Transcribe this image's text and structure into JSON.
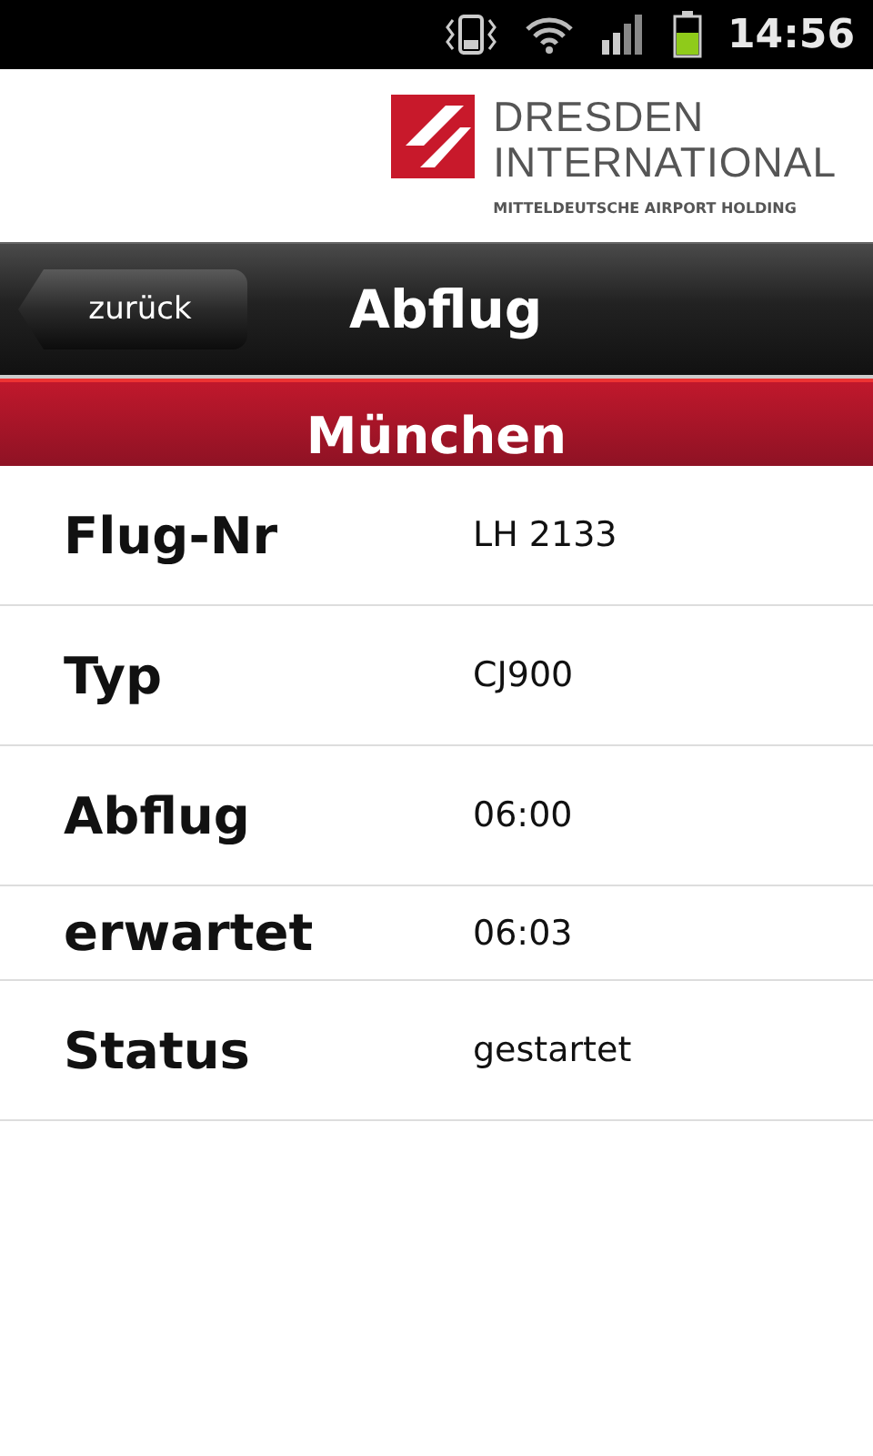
{
  "status_bar": {
    "time": "14:56"
  },
  "logo": {
    "line_1": "DRESDEN",
    "line_2": "INTERNATIONAL",
    "tagline": "MITTELDEUTSCHE AIRPORT HOLDING"
  },
  "header": {
    "back_button": "zurück",
    "title": "Abflug"
  },
  "destination": "München",
  "details": [
    {
      "label": "Flug-Nr",
      "value": "LH 2133",
      "kind": "tall"
    },
    {
      "label": "Typ",
      "value": "CJ900",
      "kind": "tall"
    },
    {
      "label": "Abflug",
      "value": "06:00",
      "kind": "tall"
    },
    {
      "label": "erwartet",
      "value": "06:03",
      "kind": "short"
    },
    {
      "label": "Status",
      "value": "gestartet",
      "kind": "tall"
    }
  ]
}
